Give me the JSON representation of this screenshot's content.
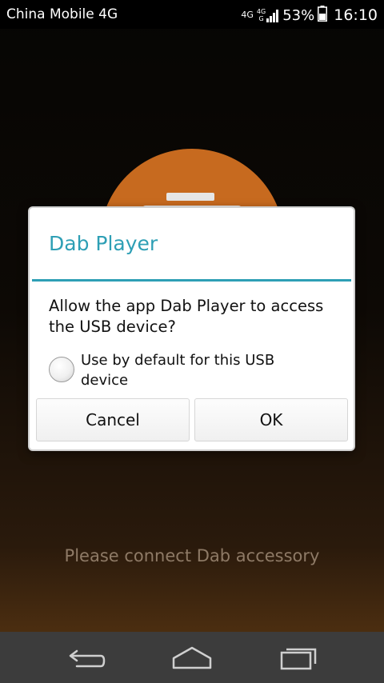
{
  "status_bar": {
    "carrier": "China Mobile 4G",
    "network_top": "4G",
    "network_bottom": "4G",
    "network_sub": "G",
    "battery": "53%",
    "time": "16:10"
  },
  "app": {
    "hint": "Please connect Dab accessory",
    "accent_color": "#c76a1f"
  },
  "dialog": {
    "title": "Dab Player",
    "message": "Allow the app Dab Player to access the USB device?",
    "default_option": {
      "label": "Use by default for this USB device",
      "checked": false
    },
    "buttons": {
      "cancel": "Cancel",
      "ok": "OK"
    },
    "accent_color": "#2e9fb5"
  },
  "nav_bar": {
    "icons": [
      "back-icon",
      "home-icon",
      "recents-icon"
    ]
  }
}
